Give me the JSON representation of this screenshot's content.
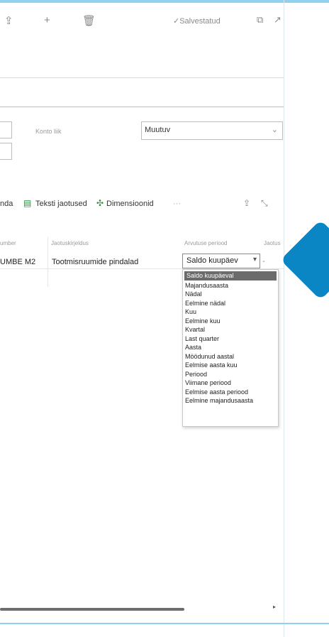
{
  "colors": {
    "accent": "#0a86c4",
    "link_green": "#2b8a3e",
    "menu_selected_bg": "#6b6b6b"
  },
  "toolbar": {
    "saved_label": "✓Salvestatud",
    "icons": [
      "share-icon",
      "plus-icon",
      "trash-icon",
      "popout-icon",
      "expand-icon"
    ]
  },
  "form": {
    "account_type_label": "Konto liik",
    "account_type_value": "Muutuv"
  },
  "actions": {
    "partial_label": "nda",
    "text_shares_label": "Teksti jaotused",
    "dimensions_label": "Dimensioonid",
    "more_label": "···"
  },
  "table": {
    "headers": [
      "umber",
      "Jaotuskirjeldus",
      "Arvutuse periood",
      "Jaotus"
    ],
    "row": {
      "number": "UMBE M2",
      "description": "Tootmisruumide pindalad",
      "period": "Saldo kuupäev",
      "extra": ""
    }
  },
  "period_options": [
    "Saldo kuupäeval",
    "Majandusaasta",
    "Nädal",
    "Eelmine nädal",
    "Kuu",
    "Eelmine kuu",
    "Kvartal",
    "Last quarter",
    "Aasta",
    "Möödunud aastal",
    "Eelmise aasta kuu",
    "Periood",
    "Viimane periood",
    "Eelmise aasta periood",
    "Eelmine majandusaasta"
  ]
}
